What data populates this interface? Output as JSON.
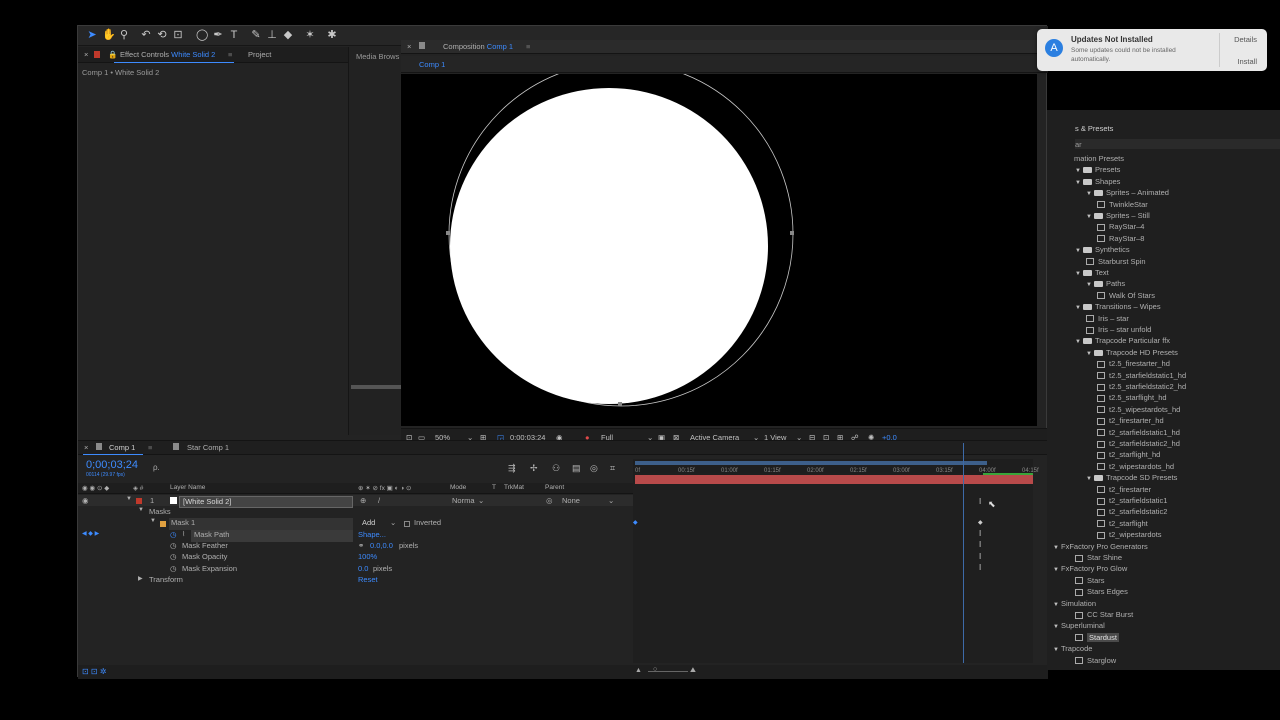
{
  "toolbar": {
    "tools": [
      "selection-tool-icon",
      "hand-tool-icon",
      "zoom-tool-icon",
      "rotate-tool-icon",
      "orbit-camera-icon",
      "pan-behind-icon",
      "ellipse-tool-icon",
      "pen-tool-icon",
      "type-tool-icon",
      "brush-tool-icon",
      "clone-stamp-icon",
      "eraser-icon",
      "roto-brush-icon",
      "puppet-pin-icon"
    ]
  },
  "left_panel": {
    "tab_effect_controls": "Effect Controls",
    "tab_effect_controls_layer": "White Solid 2",
    "tab_project": "Project",
    "tab_media_browser": "Media Brows",
    "subtitle": "Comp 1 • White Solid 2"
  },
  "comp_panel": {
    "tab_prefix": "Composition",
    "tab_name": "Comp 1",
    "breadcrumb": "Comp 1"
  },
  "viewer_bar": {
    "zoom": "50%",
    "timecode": "0;00;03;24",
    "resolution": "Full",
    "camera": "Active Camera",
    "view": "1 View",
    "exposure": "+0.0"
  },
  "notification": {
    "title": "Updates Not Installed",
    "message": "Some updates could not be installed automatically.",
    "details": "Details",
    "install": "Install"
  },
  "timeline": {
    "tab_comp1": "Comp 1",
    "tab_star": "Star Comp 1",
    "timecode": "0;00;03;24",
    "fps": "00114 (29.97 fps)",
    "search_placeholder": "ρ.",
    "col_layer_name": "Layer Name",
    "col_mode": "Mode",
    "col_t": "T",
    "col_trkmat": "TrkMat",
    "col_parent": "Parent",
    "layer_num": "1",
    "layer_name": "[White Solid 2]",
    "layer_mode": "Norma",
    "layer_parent": "None",
    "masks": "Masks",
    "mask1": "Mask 1",
    "mask1_mode": "Add",
    "inverted": "Inverted",
    "mask_path": "Mask Path",
    "mask_path_val": "Shape...",
    "mask_feather": "Mask Feather",
    "mask_feather_val": "0.0,0.0",
    "mask_feather_unit": "pixels",
    "mask_opacity": "Mask Opacity",
    "mask_opacity_val": "100%",
    "mask_expansion": "Mask Expansion",
    "mask_expansion_val": "0.0",
    "mask_expansion_unit": "pixels",
    "transform": "Transform",
    "transform_val": "Reset",
    "ruler": [
      "0f",
      "00:15f",
      "01:00f",
      "01:15f",
      "02:00f",
      "02:15f",
      "03:00f",
      "03:15f",
      "04:00f",
      "04:15f"
    ]
  },
  "presets_panel": {
    "title": "s & Presets",
    "search": "ar",
    "items": [
      {
        "label": "mation Presets",
        "indent": 0,
        "type": "text"
      },
      {
        "label": "Presets",
        "indent": 1,
        "type": "folder",
        "arrow": "▼"
      },
      {
        "label": "Shapes",
        "indent": 1,
        "type": "folder",
        "arrow": "▼"
      },
      {
        "label": "Sprites – Animated",
        "indent": 2,
        "type": "folder",
        "arrow": "▼"
      },
      {
        "label": "TwinkleStar",
        "indent": 3,
        "type": "preset"
      },
      {
        "label": "Sprites – Still",
        "indent": 2,
        "type": "folder",
        "arrow": "▼"
      },
      {
        "label": "RayStar–4",
        "indent": 3,
        "type": "preset"
      },
      {
        "label": "RayStar–8",
        "indent": 3,
        "type": "preset"
      },
      {
        "label": "Synthetics",
        "indent": 1,
        "type": "folder",
        "arrow": "▼"
      },
      {
        "label": "Starburst Spin",
        "indent": 2,
        "type": "preset"
      },
      {
        "label": "Text",
        "indent": 1,
        "type": "folder",
        "arrow": "▼"
      },
      {
        "label": "Paths",
        "indent": 2,
        "type": "folder",
        "arrow": "▼"
      },
      {
        "label": "Walk Of Stars",
        "indent": 3,
        "type": "preset"
      },
      {
        "label": "Transitions – Wipes",
        "indent": 1,
        "type": "folder",
        "arrow": "▼"
      },
      {
        "label": "Iris – star",
        "indent": 2,
        "type": "preset"
      },
      {
        "label": "Iris – star unfold",
        "indent": 2,
        "type": "preset"
      },
      {
        "label": "Trapcode Particular ffx",
        "indent": 1,
        "type": "folder",
        "arrow": "▼"
      },
      {
        "label": "Trapcode HD Presets",
        "indent": 2,
        "type": "folder",
        "arrow": "▼"
      },
      {
        "label": "t2.5_firestarter_hd",
        "indent": 3,
        "type": "preset"
      },
      {
        "label": "t2.5_starfieldstatic1_hd",
        "indent": 3,
        "type": "preset"
      },
      {
        "label": "t2.5_starfieldstatic2_hd",
        "indent": 3,
        "type": "preset"
      },
      {
        "label": "t2.5_starflight_hd",
        "indent": 3,
        "type": "preset"
      },
      {
        "label": "t2.5_wipestardots_hd",
        "indent": 3,
        "type": "preset"
      },
      {
        "label": "t2_firestarter_hd",
        "indent": 3,
        "type": "preset"
      },
      {
        "label": "t2_starfieldstatic1_hd",
        "indent": 3,
        "type": "preset"
      },
      {
        "label": "t2_starfieldstatic2_hd",
        "indent": 3,
        "type": "preset"
      },
      {
        "label": "t2_starflight_hd",
        "indent": 3,
        "type": "preset"
      },
      {
        "label": "t2_wipestardots_hd",
        "indent": 3,
        "type": "preset"
      },
      {
        "label": "Trapcode SD Presets",
        "indent": 2,
        "type": "folder",
        "arrow": "▼"
      },
      {
        "label": "t2_firestarter",
        "indent": 3,
        "type": "preset"
      },
      {
        "label": "t2_starfieldstatic1",
        "indent": 3,
        "type": "preset"
      },
      {
        "label": "t2_starfieldstatic2",
        "indent": 3,
        "type": "preset"
      },
      {
        "label": "t2_starflight",
        "indent": 3,
        "type": "preset"
      },
      {
        "label": "t2_wipestardots",
        "indent": 3,
        "type": "preset"
      },
      {
        "label": "FxFactory Pro Generators",
        "indent": 0,
        "type": "category",
        "arrow": "▼"
      },
      {
        "label": "Star Shine",
        "indent": 1,
        "type": "preset"
      },
      {
        "label": "FxFactory Pro Glow",
        "indent": 0,
        "type": "category",
        "arrow": "▼"
      },
      {
        "label": "Stars",
        "indent": 1,
        "type": "preset"
      },
      {
        "label": "Stars Edges",
        "indent": 1,
        "type": "preset"
      },
      {
        "label": "Simulation",
        "indent": 0,
        "type": "category",
        "arrow": "▼"
      },
      {
        "label": "CC Star Burst",
        "indent": 1,
        "type": "preset"
      },
      {
        "label": "Superluminal",
        "indent": 0,
        "type": "category",
        "arrow": "▼"
      },
      {
        "label": "Stardust",
        "indent": 1,
        "type": "preset",
        "selected": true
      },
      {
        "label": "Trapcode",
        "indent": 0,
        "type": "category",
        "arrow": "▼"
      },
      {
        "label": "Starglow",
        "indent": 1,
        "type": "preset"
      }
    ]
  },
  "colors": {
    "accent": "#3d8bff",
    "layer_bar": "#b84a4a",
    "label_red": "#c0392b"
  }
}
